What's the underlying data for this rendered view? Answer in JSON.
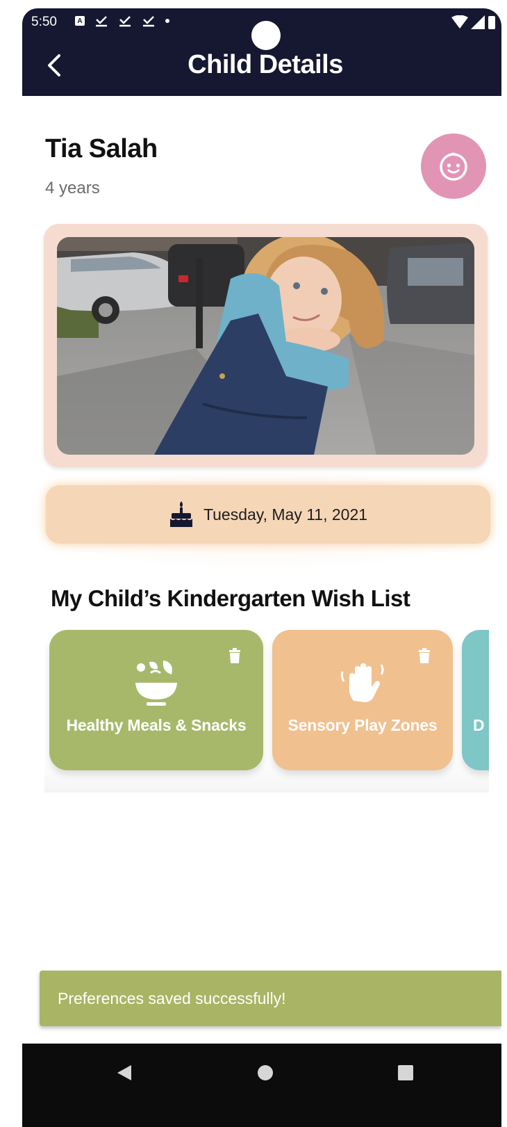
{
  "status_bar": {
    "time": "5:50"
  },
  "app_bar": {
    "title": "Child Details"
  },
  "child": {
    "name": "Tia Salah",
    "age": "4 years"
  },
  "birthday": {
    "date": "Tuesday, May 11, 2021"
  },
  "wishlist": {
    "title": "My Child’s Kindergarten Wish List",
    "items": [
      {
        "label": "Healthy Meals & Snacks",
        "color": "#a8b86b",
        "icon": "salad-bowl-icon"
      },
      {
        "label": "Sensory Play Zones",
        "color": "#f0c08f",
        "icon": "waving-hand-icon"
      },
      {
        "label": "D",
        "color": "#7fc6c6",
        "icon": ""
      }
    ]
  },
  "snackbar": {
    "message": "Preferences saved successfully!"
  },
  "colors": {
    "app_bar": "#161731",
    "avatar": "#e294b4",
    "photo_frame": "#f6dcd0",
    "birthday_pill": "#f5d6b7",
    "snackbar": "#a9b564"
  }
}
